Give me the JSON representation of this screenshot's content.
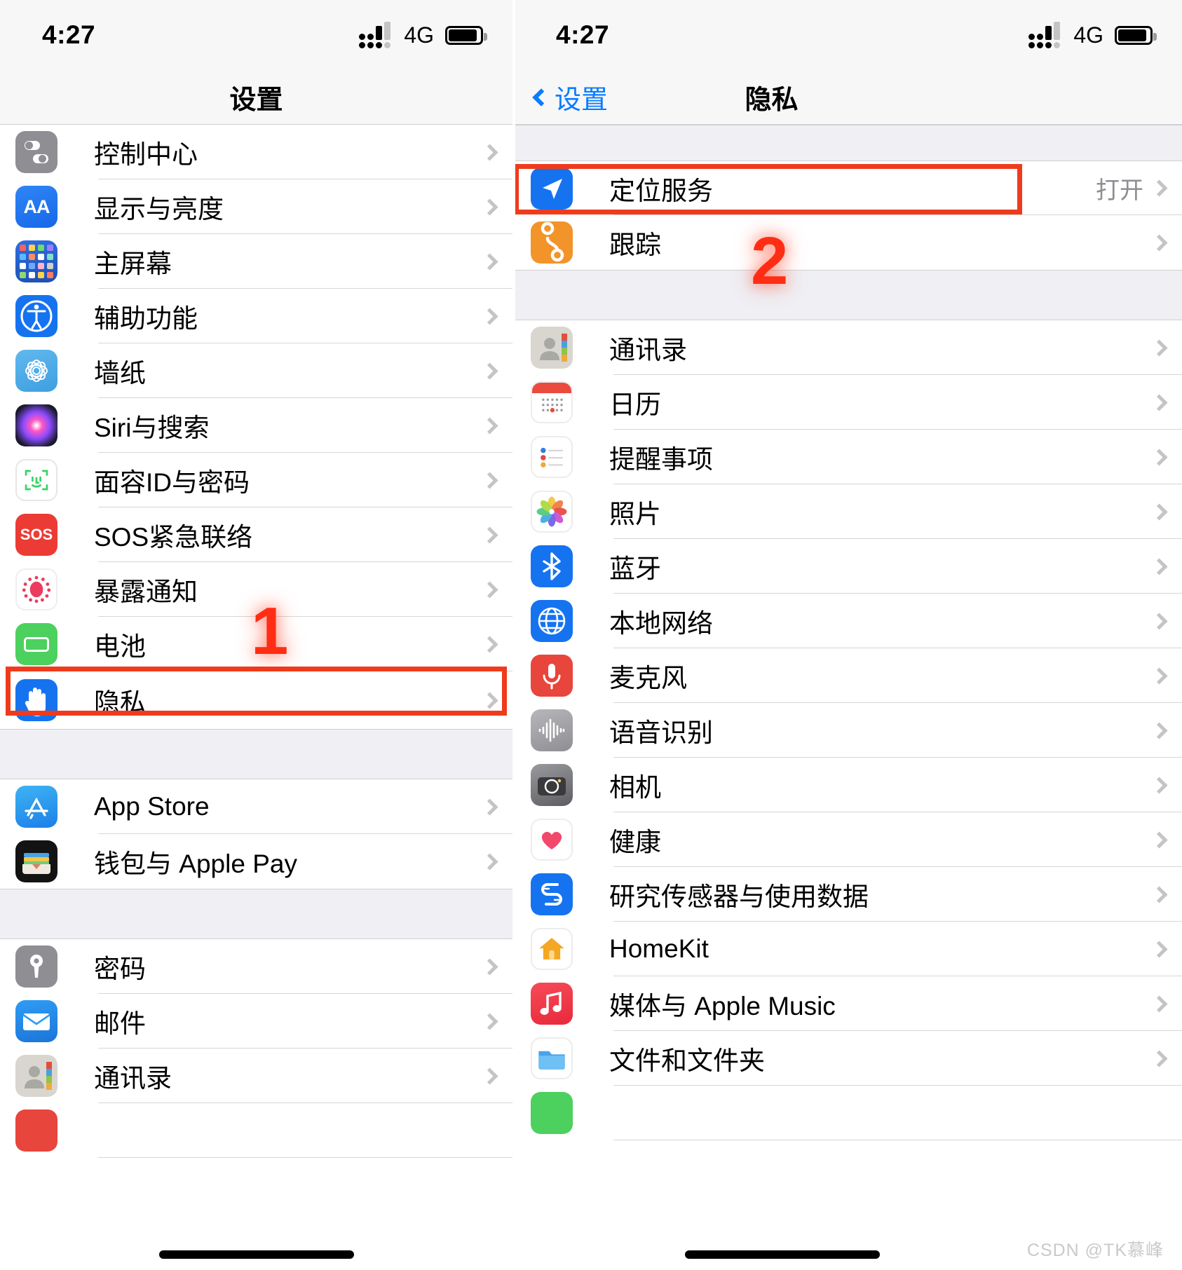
{
  "left_panel": {
    "status": {
      "time": "4:27",
      "network": "4G",
      "signal_icon": "signal-bars-icon",
      "battery_icon": "battery-icon"
    },
    "nav": {
      "title": "设置"
    },
    "groups": [
      {
        "items": [
          {
            "label": "控制中心",
            "icon": "control-center-icon",
            "accessory": "chevron-right-icon"
          },
          {
            "label": "显示与亮度",
            "icon": "display-brightness-icon",
            "accessory": "chevron-right-icon"
          },
          {
            "label": "主屏幕",
            "icon": "home-screen-icon",
            "accessory": "chevron-right-icon"
          },
          {
            "label": "辅助功能",
            "icon": "accessibility-icon",
            "accessory": "chevron-right-icon"
          },
          {
            "label": "墙纸",
            "icon": "wallpaper-icon",
            "accessory": "chevron-right-icon"
          },
          {
            "label": "Siri与搜索",
            "icon": "siri-search-icon",
            "accessory": "chevron-right-icon"
          },
          {
            "label": "面容ID与密码",
            "icon": "face-id-icon",
            "accessory": "chevron-right-icon"
          },
          {
            "label": "SOS紧急联络",
            "icon": "emergency-sos-icon",
            "accessory": "chevron-right-icon"
          },
          {
            "label": "暴露通知",
            "icon": "exposure-notification-icon",
            "accessory": "chevron-right-icon"
          },
          {
            "label": "电池",
            "icon": "battery-settings-icon",
            "accessory": "chevron-right-icon"
          },
          {
            "label": "隐私",
            "icon": "privacy-hand-icon",
            "accessory": "chevron-right-icon",
            "highlighted": true
          }
        ]
      },
      {
        "items": [
          {
            "label": "App Store",
            "icon": "app-store-icon",
            "accessory": "chevron-right-icon"
          },
          {
            "label": "钱包与 Apple Pay",
            "icon": "wallet-apple-pay-icon",
            "accessory": "chevron-right-icon"
          }
        ]
      },
      {
        "items": [
          {
            "label": "密码",
            "icon": "passwords-key-icon",
            "accessory": "chevron-right-icon"
          },
          {
            "label": "邮件",
            "icon": "mail-icon",
            "accessory": "chevron-right-icon"
          },
          {
            "label": "通讯录",
            "icon": "contacts-icon",
            "accessory": "chevron-right-icon"
          }
        ]
      }
    ],
    "annotation": {
      "step": "1"
    }
  },
  "right_panel": {
    "status": {
      "time": "4:27",
      "network": "4G",
      "signal_icon": "signal-bars-icon",
      "battery_icon": "battery-icon"
    },
    "nav": {
      "back_label": "设置",
      "back_icon": "chevron-left-icon",
      "title": "隐私"
    },
    "groups": [
      {
        "items": [
          {
            "label": "定位服务",
            "icon": "location-services-icon",
            "value": "打开",
            "accessory": "chevron-right-icon",
            "highlighted": true
          },
          {
            "label": "跟踪",
            "icon": "tracking-icon",
            "accessory": "chevron-right-icon"
          }
        ]
      },
      {
        "items": [
          {
            "label": "通讯录",
            "icon": "contacts-icon",
            "accessory": "chevron-right-icon"
          },
          {
            "label": "日历",
            "icon": "calendar-icon",
            "accessory": "chevron-right-icon"
          },
          {
            "label": "提醒事项",
            "icon": "reminders-icon",
            "accessory": "chevron-right-icon"
          },
          {
            "label": "照片",
            "icon": "photos-icon",
            "accessory": "chevron-right-icon"
          },
          {
            "label": "蓝牙",
            "icon": "bluetooth-icon",
            "accessory": "chevron-right-icon"
          },
          {
            "label": "本地网络",
            "icon": "local-network-icon",
            "accessory": "chevron-right-icon"
          },
          {
            "label": "麦克风",
            "icon": "microphone-icon",
            "accessory": "chevron-right-icon"
          },
          {
            "label": "语音识别",
            "icon": "speech-recognition-icon",
            "accessory": "chevron-right-icon"
          },
          {
            "label": "相机",
            "icon": "camera-icon",
            "accessory": "chevron-right-icon"
          },
          {
            "label": "健康",
            "icon": "health-heart-icon",
            "accessory": "chevron-right-icon"
          },
          {
            "label": "研究传感器与使用数据",
            "icon": "research-sensor-icon",
            "accessory": "chevron-right-icon"
          },
          {
            "label": "HomeKit",
            "icon": "homekit-icon",
            "accessory": "chevron-right-icon"
          },
          {
            "label": "媒体与 Apple Music",
            "icon": "apple-music-icon",
            "accessory": "chevron-right-icon"
          },
          {
            "label": "文件和文件夹",
            "icon": "files-folders-icon",
            "accessory": "chevron-right-icon"
          }
        ]
      }
    ],
    "annotation": {
      "step": "2"
    }
  },
  "watermark": "CSDN @TK慕峰",
  "colors": {
    "highlight": "#ef3b1c",
    "marker": "#ff2d14",
    "accent_blue": "#0a7cff",
    "group_bg": "#efeff4",
    "value_gray": "#8e8e93"
  }
}
